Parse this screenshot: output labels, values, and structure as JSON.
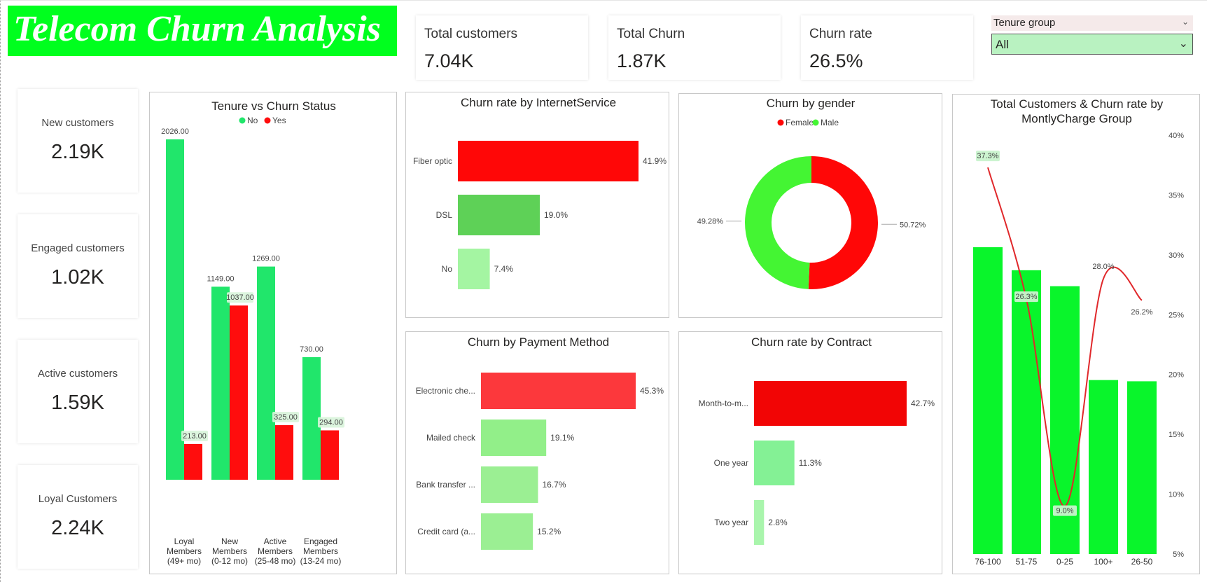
{
  "header": {
    "title": "Telecom Churn Analysis",
    "banner_color": "#00ff1e"
  },
  "kpis_top": [
    {
      "label": "Total customers",
      "value": "7.04K"
    },
    {
      "label": "Total Churn",
      "value": "1.87K"
    },
    {
      "label": "Churn rate",
      "value": "26.5%"
    }
  ],
  "kpis_side": [
    {
      "label": "New customers",
      "value": "2.19K"
    },
    {
      "label": "Engaged customers",
      "value": "1.02K"
    },
    {
      "label": "Active customers",
      "value": "1.59K"
    },
    {
      "label": "Loyal Customers",
      "value": "2.24K"
    }
  ],
  "slicer": {
    "title": "Tenure group",
    "selected": "All",
    "chevron_icon": "chevron-down-icon"
  },
  "chart_data": [
    {
      "id": "tenure",
      "type": "bar",
      "title": "Tenure vs Churn Status",
      "legend": [
        {
          "name": "No",
          "color": "#21e66b"
        },
        {
          "name": "Yes",
          "color": "#ff0d0d"
        }
      ],
      "legend_placement": "top-center",
      "categories": [
        [
          "Loyal",
          "Members",
          "(49+ mo)"
        ],
        [
          "New",
          "Members",
          "(0-12 mo)"
        ],
        [
          "Active",
          "Members",
          "(25-48 mo)"
        ],
        [
          "Engaged",
          "Members",
          "(13-24 mo)"
        ]
      ],
      "series": [
        {
          "name": "No",
          "values": [
            2026,
            1149,
            1269,
            730
          ],
          "labels": [
            "2026.00",
            "1149.00",
            "1269.00",
            "730.00"
          ],
          "color": "#21e66b"
        },
        {
          "name": "Yes",
          "values": [
            213,
            1037,
            325,
            294
          ],
          "labels": [
            "213.00",
            "1037.00",
            "325.00",
            "294.00"
          ],
          "color": "#ff0d0d"
        }
      ],
      "ylim": [
        0,
        2026
      ],
      "grid": false
    },
    {
      "id": "internet",
      "type": "bar",
      "orientation": "horizontal",
      "title": "Churn rate by InternetService",
      "categories": [
        "Fiber optic",
        "DSL",
        "No"
      ],
      "values": [
        41.9,
        19.0,
        7.4
      ],
      "labels": [
        "41.9%",
        "19.0%",
        "7.4%"
      ],
      "colors": [
        "#ff0707",
        "#5ed157",
        "#a4f5a2"
      ],
      "xlim": [
        0,
        41.9
      ]
    },
    {
      "id": "gender",
      "type": "pie",
      "donut": true,
      "title": "Churn by gender",
      "legend_placement": "top-center",
      "slices": [
        {
          "name": "Female",
          "value": 50.72,
          "label": "50.72%",
          "color": "#ff0707"
        },
        {
          "name": "Male",
          "value": 49.28,
          "label": "49.28%",
          "color": "#44f533"
        }
      ]
    },
    {
      "id": "monthly",
      "type": "bar",
      "title": "Total Customers & Churn rate by MontlyCharge Group",
      "title_lines": [
        "Total Customers & Churn rate by",
        "MontlyCharge Group"
      ],
      "categories": [
        "76-100",
        "51-75",
        "0-25",
        "100+",
        "26-50"
      ],
      "values": [
        100,
        92.5,
        87.3,
        56.7,
        56.3
      ],
      "bar_color": "#09f52b",
      "ylim": [
        0,
        100
      ],
      "line": {
        "name": "Churn rate",
        "values": [
          37.3,
          26.3,
          9.0,
          28.0,
          26.2
        ],
        "labels": [
          "37.3%",
          "26.3%",
          "9.0%",
          "28.0%",
          "26.2%"
        ],
        "color": "#e0282b"
      },
      "y2_ticks": [
        "40%",
        "35%",
        "30%",
        "25%",
        "20%",
        "15%",
        "10%",
        "5%"
      ],
      "y2_values": [
        40,
        35,
        30,
        25,
        20,
        15,
        10,
        5
      ],
      "y2lim": [
        5,
        40
      ],
      "grid": false
    },
    {
      "id": "payment",
      "type": "bar",
      "orientation": "horizontal",
      "title": "Churn by Payment Method",
      "categories": [
        "Electronic che...",
        "Mailed check",
        "Bank transfer ...",
        "Credit card (a..."
      ],
      "values": [
        45.3,
        19.1,
        16.7,
        15.2
      ],
      "labels": [
        "45.3%",
        "19.1%",
        "16.7%",
        "15.2%"
      ],
      "colors": [
        "#fc383c",
        "#92ef89",
        "#9bef93",
        "#9bef93"
      ],
      "xlim": [
        0,
        45.3
      ]
    },
    {
      "id": "contract",
      "type": "bar",
      "orientation": "horizontal",
      "title": "Churn rate by Contract",
      "categories": [
        "Month-to-m...",
        "One year",
        "Two year"
      ],
      "values": [
        42.7,
        11.3,
        2.8
      ],
      "labels": [
        "42.7%",
        "11.3%",
        "2.8%"
      ],
      "colors": [
        "#f20505",
        "#84f195",
        "#a9f5ac"
      ],
      "xlim": [
        0,
        42.7
      ]
    }
  ]
}
